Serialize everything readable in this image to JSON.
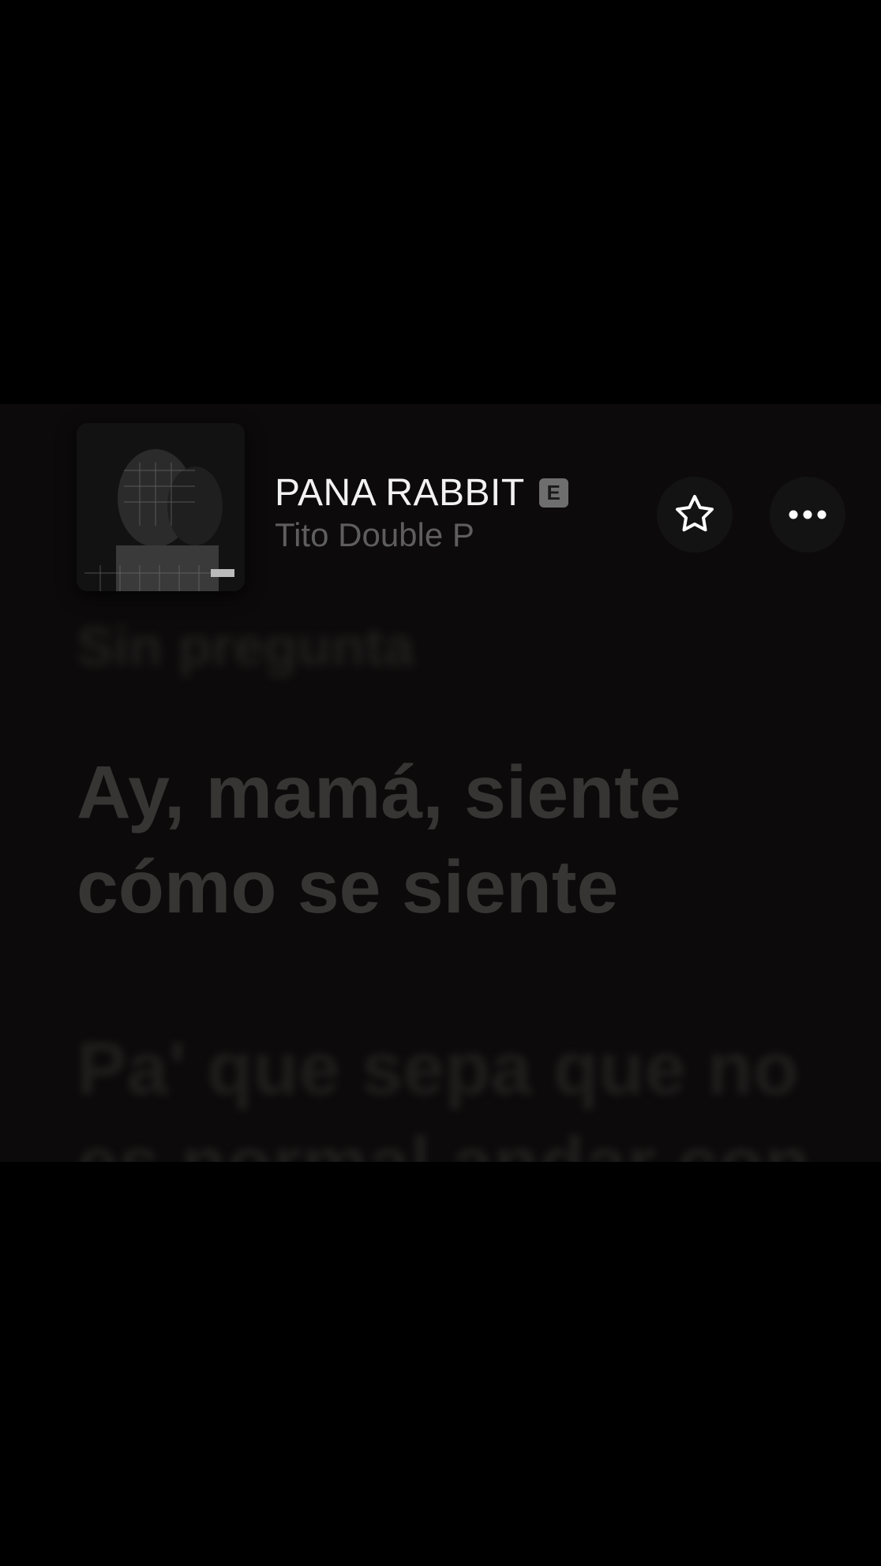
{
  "now_playing": {
    "title": "PANA RABBIT",
    "explicit_badge": "E",
    "artist": "Tito Double P",
    "artwork_icon": "album-artwork"
  },
  "actions": {
    "favorite_icon": "star-icon",
    "more_icon": "ellipsis-icon"
  },
  "lyrics": {
    "previous": "Sin pregunta",
    "current": "Ay, mamá, siente cómo se siente",
    "next": "Pa' que sepa que no es normal andar con"
  },
  "colors": {
    "background": "#000000",
    "panel": "#0c0a0a",
    "title": "#f2f2f2",
    "artist": "#5e5e5e",
    "lyric_current": "#373434"
  }
}
